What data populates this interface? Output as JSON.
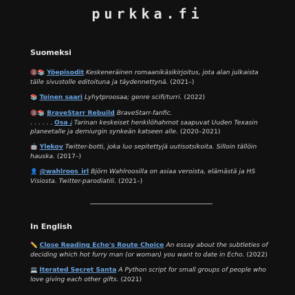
{
  "site": {
    "title": "purkka.fi"
  },
  "finnish": {
    "heading": "Suomeksi",
    "entries": [
      {
        "icon": "🔞📚",
        "link": "Yöepisodit",
        "desc": "Keskeneräinen romaanikäsikirjoitus, jota alan julkaista tälle sivustolle editoituna ja täydennettynä.",
        "meta": "(2021–)"
      },
      {
        "icon": "📚",
        "link": "Toinen saari",
        "desc": "Lyhytproosaa; genre scifi/turri.",
        "meta": "(2022)"
      },
      {
        "icon": "🔞📚",
        "link": "BraveStarr Rebuild",
        "desc": "BraveStarr-fanfic.",
        "meta": "",
        "sub": {
          "prefix": ". . . . . .",
          "link": "Osa 𝅘𝅥",
          "desc": "Tarinan keskeiset henkilöhahmot saapuvat Uuden Texasin planeetalle ja demiurgin synkeän katseen alle.",
          "meta": "(2020–2021)"
        }
      },
      {
        "icon": "🤖",
        "link": "Ylekov",
        "desc": "Twitter-botti, joka luo sepitettyjä uutisotsikoita. Silloin tällöin hauska.",
        "meta": "(2017–)"
      },
      {
        "icon": "👤",
        "link": "@wahlroos_irl",
        "desc": "Björn Wahlroosilla on asiaa veroista, elämästä ja HS Visiosta. Twitter-parodiatili.",
        "meta": "(2021–)"
      }
    ]
  },
  "english": {
    "heading": "In English",
    "entries": [
      {
        "icon": "✏️",
        "link": "Close Reading Echo's Route Choice",
        "desc": "An essay about the subtleties of deciding which hot furry man (or woman) you want to date in Echo.",
        "meta": "(2022)"
      },
      {
        "icon": "💻",
        "link": "Iterated Secret Santa",
        "desc": "A Python script for small groups of people who love giving each other gifts.",
        "meta": "(2021)"
      }
    ]
  }
}
